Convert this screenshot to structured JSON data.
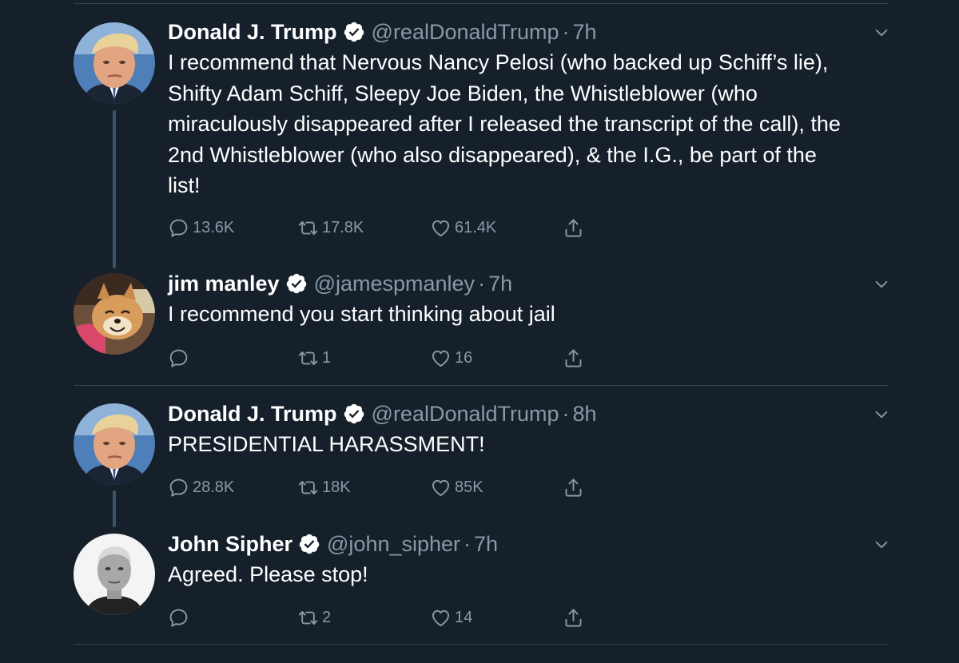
{
  "tweets": [
    {
      "name": "Donald J. Trump",
      "handle": "@realDonaldTrump",
      "time": "7h",
      "text_lines": [
        "I recommend that Nervous Nancy Pelosi (who backed up Schiff’s lie),",
        "Shifty Adam Schiff, Sleepy Joe Biden, the Whistleblower (who",
        "miraculously disappeared after I released the transcript of the call), the",
        "2nd Whistleblower (who also disappeared), & the I.G., be part of the",
        "list!"
      ],
      "replies": "13.6K",
      "retweets": "17.8K",
      "likes": "61.4K"
    },
    {
      "name": "jim manley",
      "handle": "@jamespmanley",
      "time": "7h",
      "text_lines": [
        "I recommend you start thinking about jail"
      ],
      "replies": "",
      "retweets": "1",
      "likes": "16"
    },
    {
      "name": "Donald J. Trump",
      "handle": "@realDonaldTrump",
      "time": "8h",
      "text_lines": [
        "PRESIDENTIAL HARASSMENT!"
      ],
      "replies": "28.8K",
      "retweets": "18K",
      "likes": "85K"
    },
    {
      "name": "John Sipher",
      "handle": "@john_sipher",
      "time": "7h",
      "text_lines": [
        "Agreed. Please stop!"
      ],
      "replies": "",
      "retweets": "2",
      "likes": "14"
    }
  ],
  "separator": "·",
  "icons": {
    "verified": "verified-badge-icon",
    "reply": "reply-icon",
    "retweet": "retweet-icon",
    "like": "heart-icon",
    "share": "share-icon",
    "more": "chevron-down-icon"
  },
  "colors": {
    "background": "#15202b",
    "secondary_text": "#8899a6",
    "divider": "#38444d",
    "thread_line": "#3d5466"
  }
}
